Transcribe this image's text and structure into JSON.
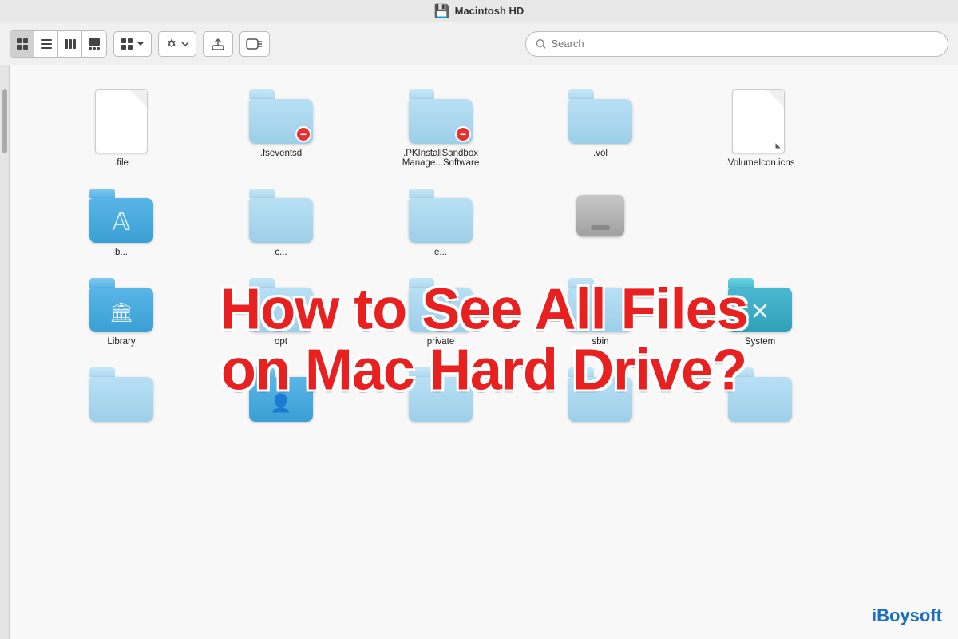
{
  "titleBar": {
    "title": "Macintosh HD",
    "hdIcon": "💿"
  },
  "toolbar": {
    "viewIcons": [
      {
        "id": "icon-view",
        "symbol": "⊞",
        "active": true
      },
      {
        "id": "list-view",
        "symbol": "☰",
        "active": false
      },
      {
        "id": "column-view",
        "symbol": "⊟",
        "active": false
      },
      {
        "id": "gallery-view",
        "symbol": "⊡",
        "active": false
      }
    ],
    "groupByLabel": "⊞",
    "actionLabel": "⚙",
    "shareLabel": "⬆",
    "tagLabel": "⬭",
    "searchPlaceholder": "Search"
  },
  "overlay": {
    "line1": "How to See All Files",
    "line2": "on Mac Hard Drive?"
  },
  "brand": {
    "prefix": "i",
    "name": "Boysoft"
  },
  "fileRows": [
    {
      "row": 1,
      "items": [
        {
          "type": "file",
          "name": ".file",
          "restricted": false
        },
        {
          "type": "folder",
          "name": ".fseventsd",
          "restricted": true,
          "variant": "light"
        },
        {
          "type": "folder",
          "name": ".PKInstallSandbox\nManage...Software",
          "restricted": true,
          "variant": "light"
        },
        {
          "type": "folder",
          "name": ".vol",
          "restricted": false,
          "variant": "light"
        },
        {
          "type": "file-alias",
          "name": ".VolumeIcon.icns",
          "restricted": false
        }
      ]
    },
    {
      "row": 2,
      "items": [
        {
          "type": "folder",
          "name": "b...",
          "restricted": false,
          "variant": "dark-blue",
          "inner": "A"
        },
        {
          "type": "folder",
          "name": "c...",
          "restricted": false,
          "variant": "light"
        },
        {
          "type": "folder",
          "name": "e...",
          "restricted": false,
          "variant": "light"
        },
        {
          "type": "drive",
          "name": "",
          "restricted": false
        }
      ]
    },
    {
      "row": 3,
      "items": [
        {
          "type": "folder",
          "name": "Library",
          "restricted": false,
          "variant": "dark-blue",
          "inner": "🏛"
        },
        {
          "type": "folder",
          "name": "opt",
          "restricted": false,
          "variant": "light"
        },
        {
          "type": "folder",
          "name": "private",
          "restricted": false,
          "variant": "light"
        },
        {
          "type": "folder",
          "name": "sbin",
          "restricted": false,
          "variant": "light"
        },
        {
          "type": "folder",
          "name": "System",
          "restricted": false,
          "variant": "teal-x",
          "inner": "✕"
        }
      ]
    },
    {
      "row": 4,
      "items": [
        {
          "type": "folder",
          "name": "",
          "restricted": false,
          "variant": "light"
        },
        {
          "type": "folder",
          "name": "",
          "restricted": false,
          "variant": "dark-blue",
          "inner": "👤"
        },
        {
          "type": "folder",
          "name": "",
          "restricted": false,
          "variant": "light"
        },
        {
          "type": "folder",
          "name": "",
          "restricted": false,
          "variant": "light"
        },
        {
          "type": "folder",
          "name": "",
          "restricted": false,
          "variant": "light"
        }
      ]
    }
  ]
}
